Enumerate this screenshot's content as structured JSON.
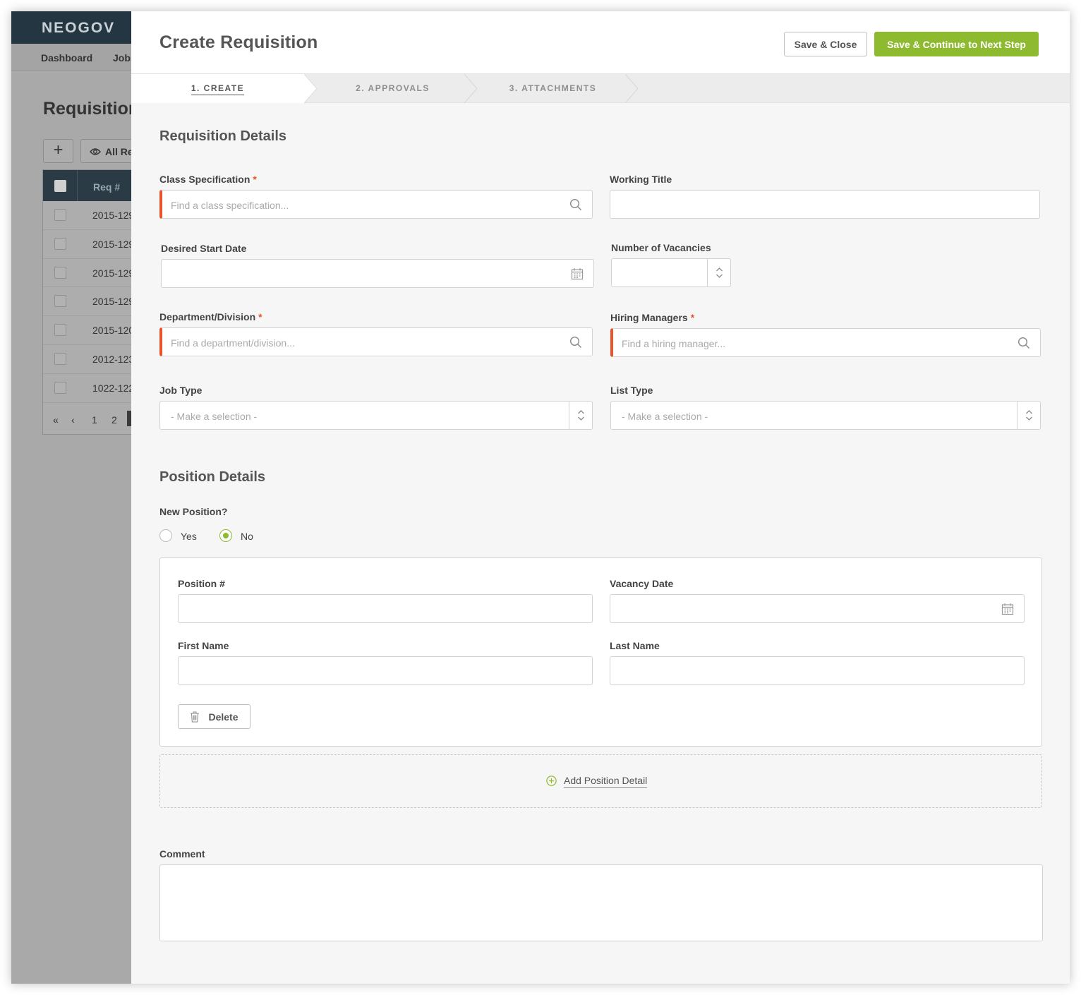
{
  "background": {
    "logo": "NEOGOV",
    "nav": [
      "Dashboard",
      "Jobs"
    ],
    "page_title": "Requisitions",
    "filter_label": "All Re",
    "table": {
      "header": "Req #",
      "rows": [
        "2015-129",
        "2015-129",
        "2015-129",
        "2015-129",
        "2015-120",
        "2012-123",
        "1022-122"
      ]
    },
    "pager": [
      "«",
      "‹",
      "1",
      "2"
    ]
  },
  "modal": {
    "title": "Create Requisition",
    "save_close": "Save & Close",
    "save_continue": "Save & Continue to Next Step"
  },
  "steps": [
    "1. CREATE",
    "2. APPROVALS",
    "3. ATTACHMENTS"
  ],
  "requisition_details": {
    "title": "Requisition Details",
    "class_spec": {
      "label": "Class Specification",
      "placeholder": "Find a class specification..."
    },
    "working_title": {
      "label": "Working Title",
      "value": ""
    },
    "start_date": {
      "label": "Desired Start Date",
      "value": ""
    },
    "vacancies": {
      "label": "Number of Vacancies",
      "value": ""
    },
    "department": {
      "label": "Department/Division",
      "placeholder": "Find a department/division..."
    },
    "hiring_managers": {
      "label": "Hiring Managers",
      "placeholder": "Find a hiring manager..."
    },
    "job_type": {
      "label": "Job Type",
      "value": "- Make a selection -"
    },
    "list_type": {
      "label": "List Type",
      "value": "- Make a selection -"
    },
    "required_mark": "*"
  },
  "position_details": {
    "title": "Position Details",
    "new_position": {
      "label": "New Position?",
      "options": [
        "Yes",
        "No"
      ],
      "selected": "No"
    },
    "position_num": {
      "label": "Position #",
      "value": ""
    },
    "vacancy_date": {
      "label": "Vacancy Date",
      "value": ""
    },
    "first_name": {
      "label": "First Name",
      "value": ""
    },
    "last_name": {
      "label": "Last Name",
      "value": ""
    },
    "delete_label": "Delete",
    "add_label": "Add Position Detail"
  },
  "comment": {
    "label": "Comment",
    "value": ""
  },
  "colors": {
    "accent": "#8dba2f",
    "required": "#e8542c",
    "header_dark": "#233642"
  }
}
